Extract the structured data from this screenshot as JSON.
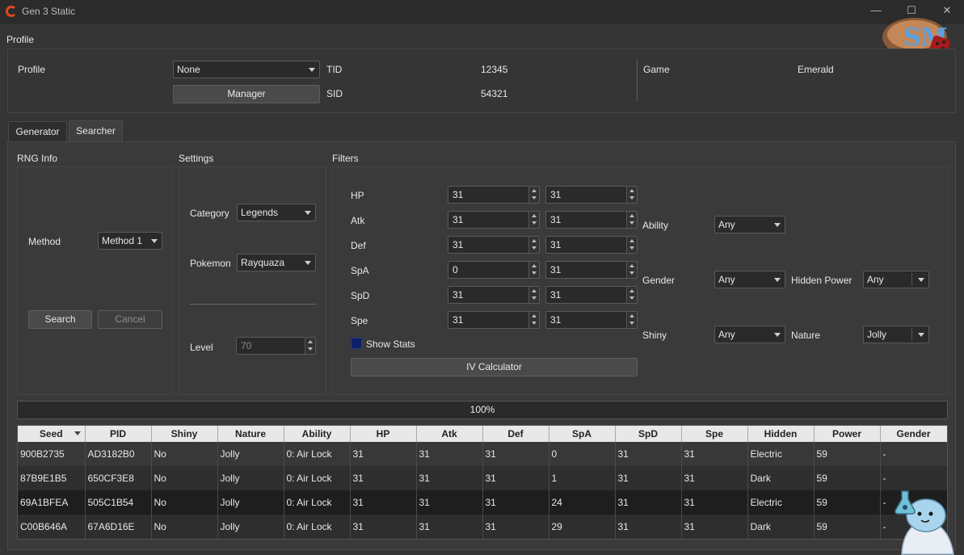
{
  "window": {
    "title": "Gen 3 Static",
    "min": "—",
    "max": "☐",
    "close": "✕"
  },
  "profile": {
    "section": "Profile",
    "label": "Profile",
    "value": "None",
    "manager": "Manager",
    "tid_label": "TID",
    "tid": "12345",
    "sid_label": "SID",
    "sid": "54321",
    "game_label": "Game",
    "game": "Emerald"
  },
  "tabs": [
    {
      "label": "Generator"
    },
    {
      "label": "Searcher"
    }
  ],
  "rng": {
    "title": "RNG Info",
    "method_label": "Method",
    "method": "Method 1",
    "search": "Search",
    "cancel": "Cancel"
  },
  "settings": {
    "title": "Settings",
    "category_label": "Category",
    "category": "Legends",
    "pokemon_label": "Pokemon",
    "pokemon": "Rayquaza",
    "level_label": "Level",
    "level": "70"
  },
  "filters": {
    "title": "Filters",
    "ivs": [
      {
        "label": "HP",
        "min": "31",
        "max": "31"
      },
      {
        "label": "Atk",
        "min": "31",
        "max": "31"
      },
      {
        "label": "Def",
        "min": "31",
        "max": "31"
      },
      {
        "label": "SpA",
        "min": "0",
        "max": "31"
      },
      {
        "label": "SpD",
        "min": "31",
        "max": "31"
      },
      {
        "label": "Spe",
        "min": "31",
        "max": "31"
      }
    ],
    "show_stats": "Show Stats",
    "iv_calc": "IV Calculator",
    "ability_label": "Ability",
    "ability": "Any",
    "gender_label": "Gender",
    "gender": "Any",
    "hp_label": "Hidden Power",
    "hp": "Any",
    "shiny_label": "Shiny",
    "shiny": "Any",
    "nature_label": "Nature",
    "nature": "Jolly"
  },
  "progress": "100%",
  "table": {
    "headers": [
      "Seed",
      "PID",
      "Shiny",
      "Nature",
      "Ability",
      "HP",
      "Atk",
      "Def",
      "SpA",
      "SpD",
      "Spe",
      "Hidden",
      "Power",
      "Gender"
    ],
    "rows": [
      [
        "900B2735",
        "AD3182B0",
        "No",
        "Jolly",
        "0: Air Lock",
        "31",
        "31",
        "31",
        "0",
        "31",
        "31",
        "Electric",
        "59",
        "-"
      ],
      [
        "87B9E1B5",
        "650CF3E8",
        "No",
        "Jolly",
        "0: Air Lock",
        "31",
        "31",
        "31",
        "1",
        "31",
        "31",
        "Dark",
        "59",
        "-"
      ],
      [
        "69A1BFEA",
        "505C1B54",
        "No",
        "Jolly",
        "0: Air Lock",
        "31",
        "31",
        "31",
        "24",
        "31",
        "31",
        "Electric",
        "59",
        "-"
      ],
      [
        "C00B646A",
        "67A6D16E",
        "No",
        "Jolly",
        "0: Air Lock",
        "31",
        "31",
        "31",
        "29",
        "31",
        "31",
        "Dark",
        "59",
        "-"
      ]
    ]
  },
  "colors": {
    "accent": "#e0481a",
    "checkbox": "#0d1f6b"
  }
}
